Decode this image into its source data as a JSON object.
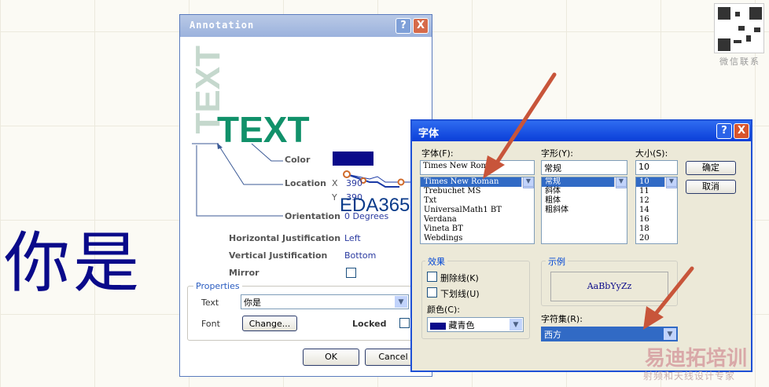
{
  "background": {
    "big_text": "你是"
  },
  "qr": {
    "label": "微信联系"
  },
  "watermark": {
    "line1": "易迪拓培训",
    "line2": "射频和天线设计专家"
  },
  "annotation": {
    "title": "Annotation",
    "help": "?",
    "close": "X",
    "preview_vertical": "TEXT",
    "preview_horizontal": "TEXT",
    "labels": {
      "color": "Color",
      "location": "Location",
      "orientation": "Orientation",
      "hjust": "Horizontal Justification",
      "vjust": "Vertical Justification",
      "mirror": "Mirror",
      "x": "X",
      "y": "Y"
    },
    "values": {
      "x": "390",
      "y": "390",
      "orientation": "0 Degrees",
      "hjust": "Left",
      "vjust": "Bottom"
    },
    "properties": {
      "title": "Properties",
      "text_label": "Text",
      "text_value": "你是",
      "font_label": "Font",
      "change_button": "Change...",
      "locked_label": "Locked"
    },
    "ok": "OK",
    "cancel": "Cancel",
    "overlay": "EDA365"
  },
  "font_dialog": {
    "title": "字体",
    "help": "?",
    "close": "X",
    "font_label": "字体(F):",
    "style_label": "字形(Y):",
    "size_label": "大小(S):",
    "font_value": "Times New Roman",
    "style_value": "常规",
    "size_value": "10",
    "fonts": [
      "Times New Roman",
      "Trebuchet MS",
      "Txt",
      "UniversalMath1 BT",
      "Verdana",
      "Vineta BT",
      "Webdings"
    ],
    "styles": [
      "常规",
      "斜体",
      "粗体",
      "粗斜体"
    ],
    "sizes": [
      "10",
      "11",
      "12",
      "14",
      "16",
      "18",
      "20"
    ],
    "ok": "确定",
    "cancel": "取消",
    "effects": {
      "title": "效果",
      "strike": "删除线(K)",
      "underline": "下划线(U)",
      "color_label": "颜色(C):",
      "color_value": "藏青色"
    },
    "sample": {
      "title": "示例",
      "text": "AaBbYyZz"
    },
    "charset": {
      "label": "字符集(R):",
      "value": "西方"
    }
  }
}
